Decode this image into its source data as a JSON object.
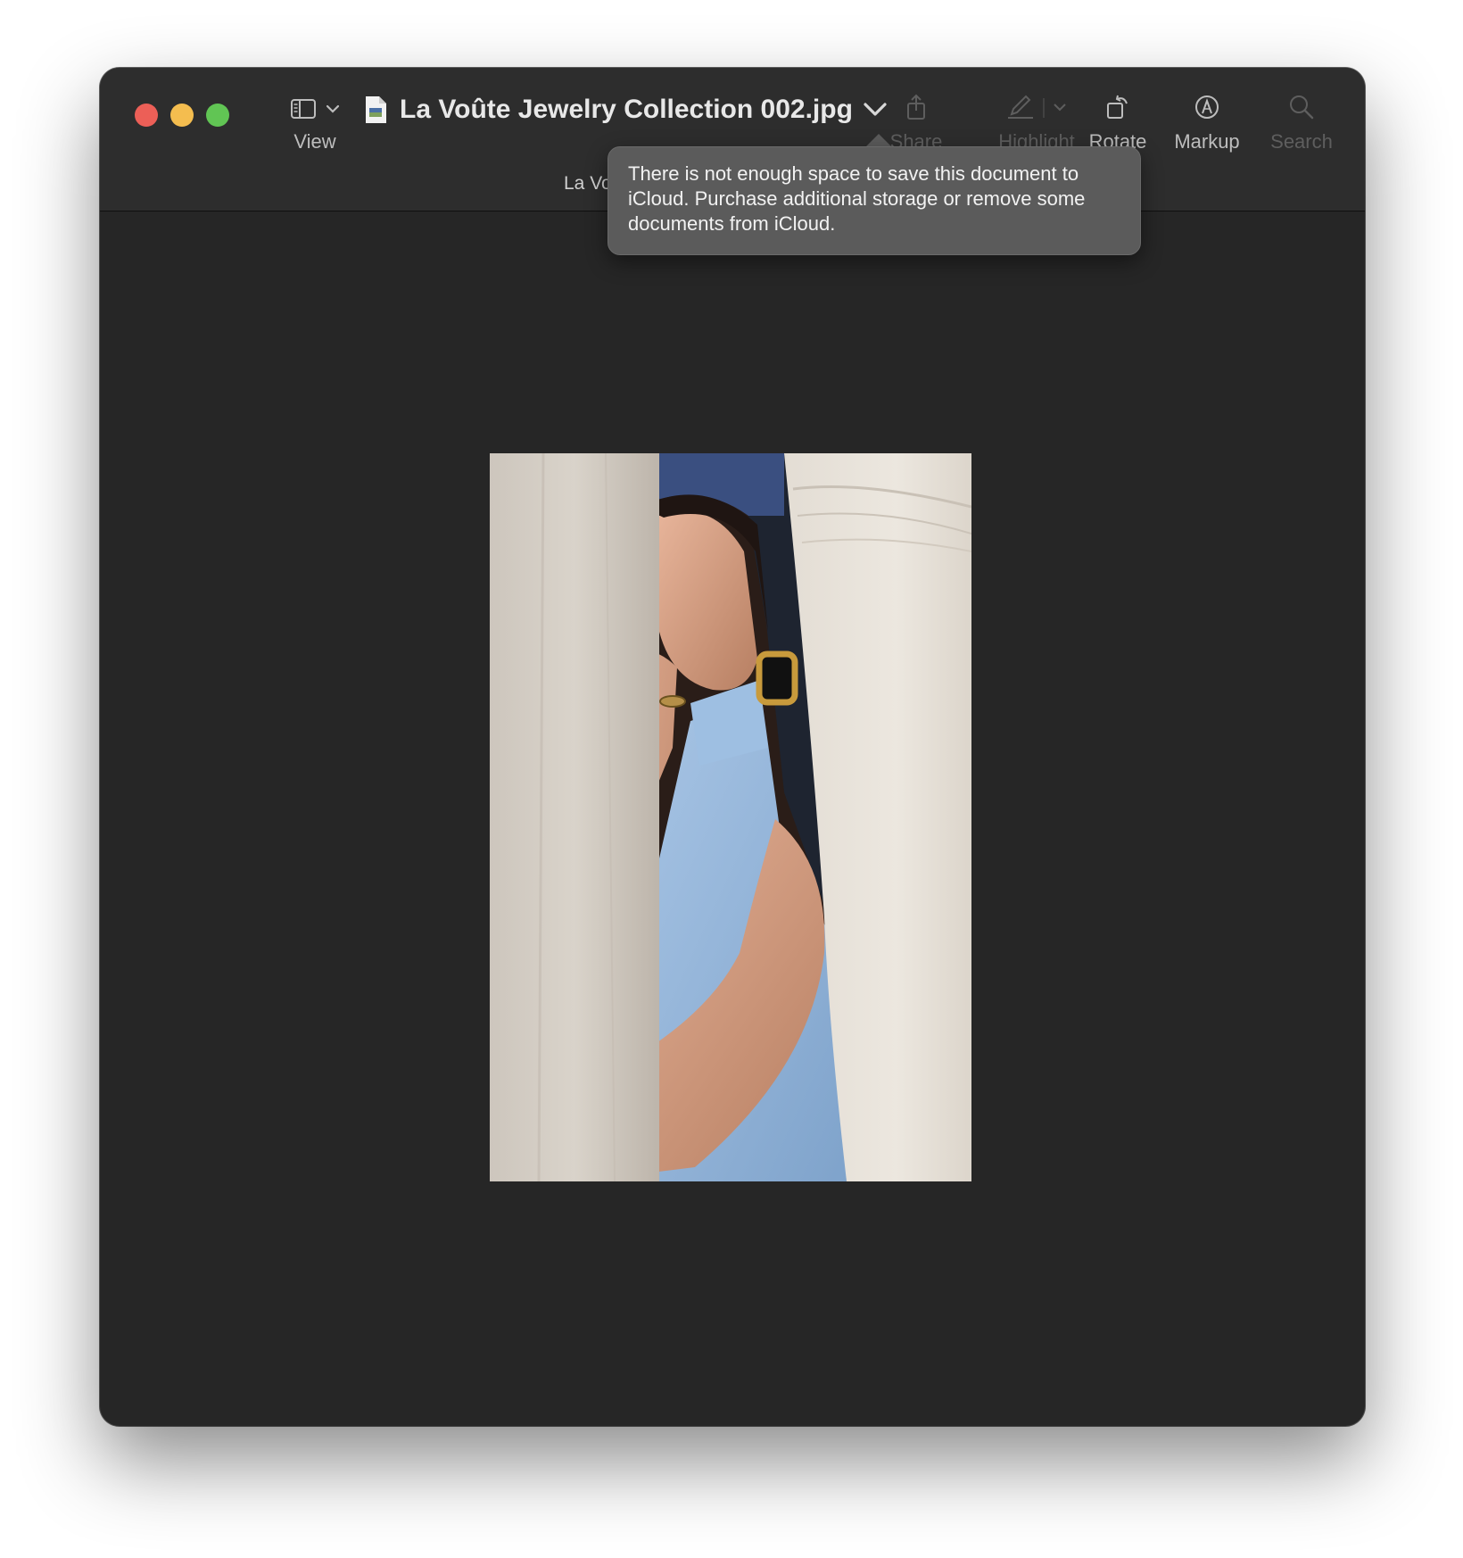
{
  "window": {
    "title": "La Voûte Jewelry Collection 002.jpg",
    "subtitle": "La Vo",
    "traffic_lights": {
      "close": "#ec5f57",
      "minimize": "#f4bd4f",
      "maximize": "#61c554"
    }
  },
  "toolbar": {
    "view_label": "View",
    "share_label": "Share",
    "highlight_label": "Highlight",
    "rotate_label": "Rotate",
    "markup_label": "Markup",
    "search_label": "Search"
  },
  "icons": {
    "sidebar": "sidebar-icon",
    "chevron": "chevron-down-icon",
    "document": "document-icon",
    "share": "share-icon",
    "highlight": "pen-icon",
    "rotate": "rotate-icon",
    "markup": "markup-icon",
    "search": "search-icon"
  },
  "tooltip": {
    "message": "There is not enough space to save this document to iCloud. Purchase additional storage or remove some documents from iCloud."
  },
  "colors": {
    "window_bg": "#262626",
    "toolbar_bg": "#2d2d2d",
    "tooltip_bg": "#5b5b5b"
  }
}
